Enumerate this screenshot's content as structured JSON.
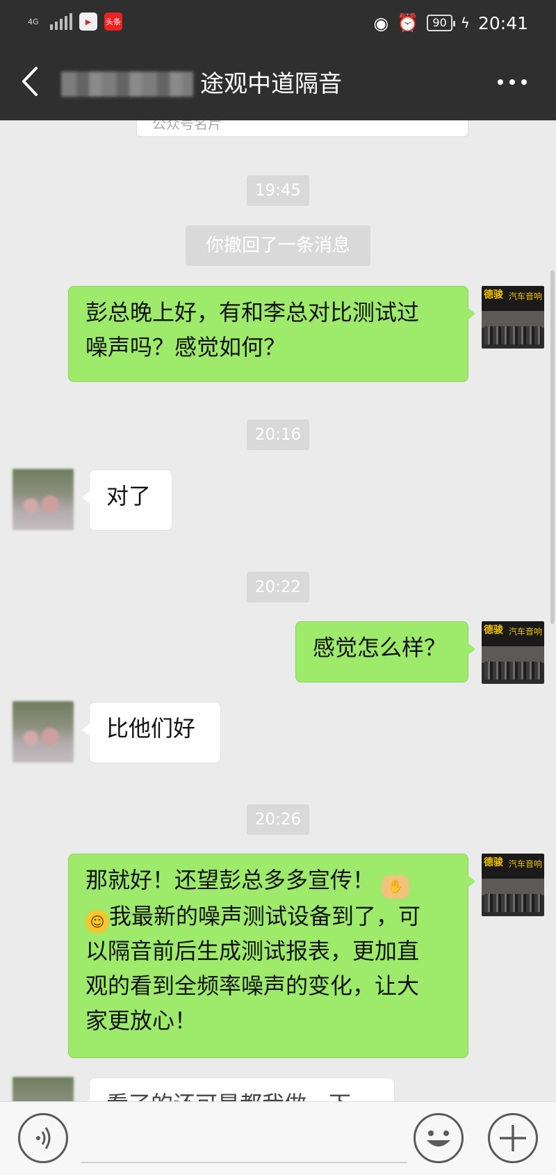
{
  "status_bar": {
    "network": "4G",
    "app1_label": "",
    "app2_label": "头条",
    "battery": "90",
    "time": "20:41"
  },
  "header": {
    "title": "途观中道隔音"
  },
  "chat": {
    "card_stub_text": "公众号名片",
    "messages": [
      {
        "type": "time",
        "text": "19:45"
      },
      {
        "type": "system",
        "text": "你撤回了一条消息"
      },
      {
        "type": "out",
        "lines": [
          "彭总晚上好，有和李总对比测试过",
          "噪声吗？感觉如何？"
        ]
      },
      {
        "type": "time",
        "text": "20:16"
      },
      {
        "type": "in",
        "text": "对了"
      },
      {
        "type": "time",
        "text": "20:22"
      },
      {
        "type": "out",
        "text": "感觉怎么样？"
      },
      {
        "type": "in",
        "text": "比他们好"
      },
      {
        "type": "time",
        "text": "20:26"
      },
      {
        "type": "out",
        "line1": "那就好！还望彭总多多宣传！",
        "line2": "我最新的噪声测试设备到了，可",
        "line3": "以隔音前后生成测试报表，更加直",
        "line4": "观的看到全频率噪声的变化，让大",
        "line5": "家更放心！"
      },
      {
        "type": "in",
        "partial": true,
        "text": "看了的还可是都我做一下"
      }
    ],
    "avatar_self": {
      "brand_left": "德骏",
      "brand_right": "汽车音响"
    }
  },
  "input_bar": {
    "voice_icon": "voice-icon",
    "emoji_icon": "emoji-icon",
    "plus_icon": "plus-icon"
  }
}
